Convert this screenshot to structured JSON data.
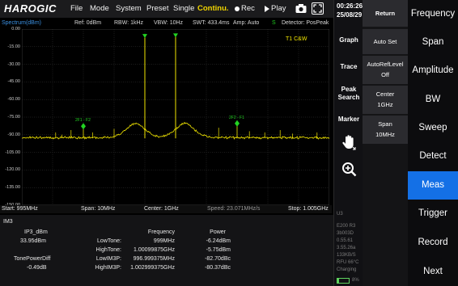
{
  "app": {
    "logo": "HAROGIC"
  },
  "menubar": {
    "items": [
      "File",
      "Mode",
      "System",
      "Preset",
      "Single"
    ],
    "continuous": "Continu.",
    "rec": "Rec",
    "play": "Play"
  },
  "info": {
    "title": "Spectrum(dBm)",
    "ref": "Ref: 0dBm",
    "rbw": "RBW: 1kHz",
    "vbw": "VBW: 10Hz",
    "swt": "SWT: 433.4ms",
    "amp": "Amp: Auto",
    "s": "S",
    "detector": "Detector: PosPeak"
  },
  "trace_label": "T1 C&W",
  "y_ticks": [
    "0.00",
    "-15.00",
    "-30.00",
    "-45.00",
    "-60.00",
    "-75.00",
    "-90.00",
    "-105.00",
    "-120.00",
    "-135.00",
    "-150.00"
  ],
  "marker_labels": {
    "left": "2F1 - F2",
    "right": "2F2 - F1"
  },
  "axis": {
    "start": "Start: 995MHz",
    "span": "Span: 10MHz",
    "center": "Center: 1GHz",
    "speed": "Speed: 23.071MHz/s",
    "stop": "Stop: 1.005GHz"
  },
  "chart_data": {
    "type": "line",
    "xlim": [
      995,
      1005
    ],
    "ylim": [
      -150,
      0
    ],
    "xlabel": "",
    "ylabel": "",
    "noise_floor": -93,
    "tones": [
      {
        "freq_mhz": 999,
        "level": -6.24
      },
      {
        "freq_mhz": 1000,
        "level": -5.75
      }
    ],
    "humps": [
      {
        "freq_mhz": 998.7,
        "level": -80
      },
      {
        "freq_mhz": 1000.3,
        "level": -80
      }
    ],
    "markers": [
      {
        "freq_mhz": 997,
        "level": -82.7
      },
      {
        "freq_mhz": 1002,
        "level": -80.37
      }
    ]
  },
  "results": {
    "heading": "IM3",
    "ip3_label": "IP3_dBm",
    "ip3_value": "33.95dBm",
    "tpd_label": "TonePowerDiff",
    "tpd_value": "-0.49dB",
    "col_freq": "Frequency",
    "col_power": "Power",
    "rows": [
      {
        "label": "LowTone:",
        "freq": "999MHz",
        "power": "-6.24dBm"
      },
      {
        "label": "HighTone:",
        "freq": "1.00099875GHz",
        "power": "-5.75dBm"
      },
      {
        "label": "LowIM3P:",
        "freq": "996.999375MHz",
        "power": "-82.70dBc"
      },
      {
        "label": "HighIM3P:",
        "freq": "1.002999375GHz",
        "power": "-80.37dBc"
      }
    ]
  },
  "status": {
    "time": "00:26:26",
    "date": "25/08/29",
    "graph": "Graph",
    "trace": "Trace",
    "peak1": "Peak",
    "peak2": "Search",
    "marker": "Marker",
    "lines": [
      "U3",
      "E200 R3",
      "3b003D",
      "0.55.61",
      "3.55.26a",
      "133KB/S",
      "RFU 66°C",
      "Charging"
    ],
    "battery": "8%"
  },
  "subpanel": {
    "return": "Return",
    "auto_set": "Auto Set",
    "auto_ref_label": "AutoRefLevel",
    "auto_ref_value": "Off",
    "center_label": "Center",
    "center_value": "1GHz",
    "span_label": "Span",
    "span_value": "10MHz"
  },
  "mainmenu": [
    "Frequency",
    "Span",
    "Amplitude",
    "BW",
    "Sweep",
    "Detect",
    "Meas",
    "Trigger",
    "Record",
    "Next"
  ],
  "colors": {
    "trace": "#f2e600",
    "marker": "#22d322",
    "active": "#1470e6",
    "accent": "#f2d500"
  }
}
